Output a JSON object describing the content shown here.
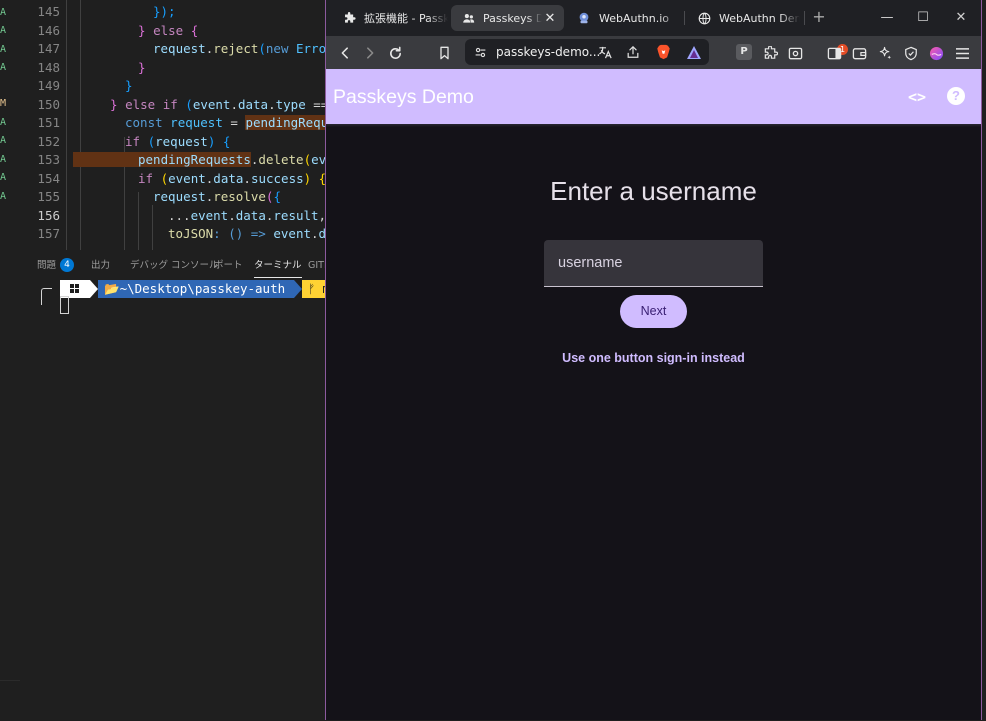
{
  "vscode": {
    "git_marks": [
      {
        "mark": "A"
      },
      {
        "mark": "A"
      },
      {
        "mark": "A"
      },
      {
        "mark": "A"
      },
      {
        "mark": "M"
      },
      {
        "mark": "A"
      },
      {
        "mark": "A"
      },
      {
        "mark": "A"
      },
      {
        "mark": "A"
      },
      {
        "mark": "A"
      }
    ],
    "line_numbers": [
      "145",
      "146",
      "147",
      "148",
      "149",
      "150",
      "151",
      "152",
      "153",
      "154",
      "155",
      "156",
      "157"
    ],
    "code": {
      "l145": "});",
      "l146_a": "} ",
      "l146_b": "else",
      "l146_c": " {",
      "l147_a": "request",
      "l147_b": ".",
      "l147_c": "reject",
      "l147_d": "(",
      "l147_e": "new",
      "l147_f": " Error",
      "l148": "}",
      "l149": "}",
      "l150_a": "} ",
      "l150_b": "else if",
      "l150_c": " (",
      "l150_d": "event",
      "l150_e": ".",
      "l150_f": "data",
      "l150_g": ".",
      "l150_h": "type",
      "l150_i": " ===",
      "l151_a": "const",
      "l151_b": " request",
      "l151_c": " = ",
      "l151_d": "pendingReque",
      "l152_a": "if",
      "l152_b": " (",
      "l152_c": "request",
      "l152_d": ") {",
      "l153_a": "pendingRequests",
      "l153_b": ".",
      "l153_c": "delete",
      "l153_d": "(",
      "l153_e": "eve",
      "l154_a": "if",
      "l154_b": " (",
      "l154_c": "event",
      "l154_d": ".",
      "l154_e": "data",
      "l154_f": ".",
      "l154_g": "success",
      "l154_h": ") {",
      "l155_a": "request",
      "l155_b": ".",
      "l155_c": "resolve",
      "l155_d": "(",
      "l155_e": "{",
      "l156_a": "...",
      "l156_b": "event",
      "l156_c": ".",
      "l156_d": "data",
      "l156_e": ".",
      "l156_f": "result",
      "l156_g": ",",
      "l157_a": "toJSON",
      "l157_b": ": () => ",
      "l157_c": "event",
      "l157_d": ".",
      "l157_e": "da"
    },
    "panel_tabs": {
      "problems": "問題",
      "problems_count": "4",
      "output": "出力",
      "debug_console": "デバッグ コンソール",
      "ports": "ポート",
      "terminal": "ターミナル",
      "gitlens": "GITL"
    },
    "terminal": {
      "path": "📂~\\Desktop\\passkey-auth",
      "git": "ᚠ m"
    }
  },
  "browser": {
    "tabs": [
      {
        "title": "拡張機能 - Passkeys Demo",
        "icon": "puzzle-icon",
        "active": false
      },
      {
        "title": "Passkeys Demo",
        "icon": "people-icon",
        "active": true
      },
      {
        "title": "WebAuthn.io",
        "icon": "webauthn-io-icon",
        "active": false
      },
      {
        "title": "WebAuthn Demo",
        "icon": "globe-icon",
        "active": false
      }
    ],
    "tab_close": "✕",
    "new_tab": "+",
    "window_controls": {
      "minimize": "—",
      "maximize": "☐",
      "close": "✕"
    },
    "url": "passkeys-demo...",
    "brave_rewards_badge": "1",
    "profile_letter": "P"
  },
  "page": {
    "app_title": "Passkeys Demo",
    "code_icon": "<>",
    "help_icon": "?",
    "heading": "Enter a username",
    "username_placeholder": "username",
    "next_label": "Next",
    "alt_link": "Use one button sign-in instead"
  },
  "colors": {
    "accent": "#d0bcff",
    "page_background": "#141218",
    "field_background": "#36343b",
    "next_text": "#381e72",
    "editor_background": "#1f1f1f"
  }
}
